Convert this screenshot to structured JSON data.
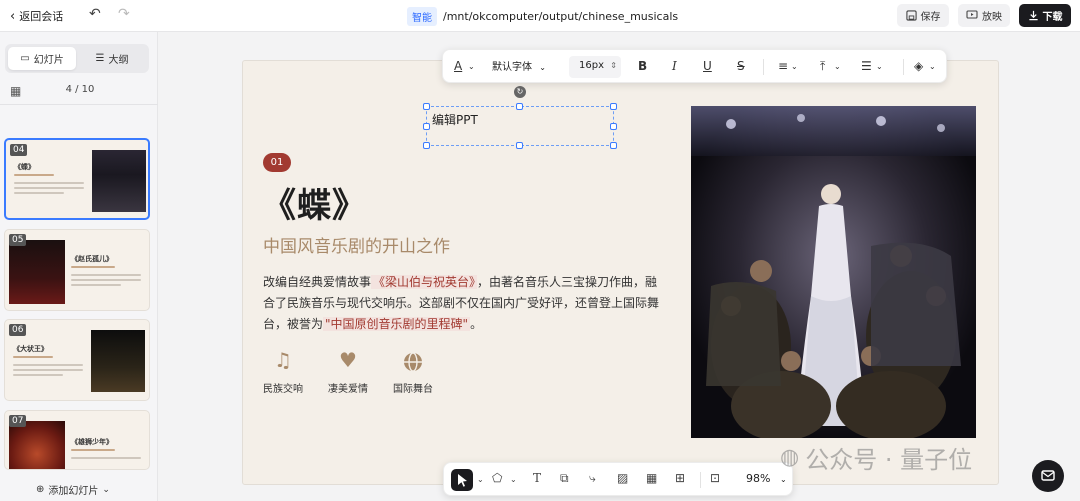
{
  "topbar": {
    "back_label": "返回会话",
    "mode_badge": "智能",
    "path": "/mnt/okcomputer/output/chinese_musicals",
    "save_label": "保存",
    "present_label": "放映",
    "download_label": "下载"
  },
  "sidebar": {
    "tab_slides": "幻灯片",
    "tab_outline": "大纲",
    "page_indicator": "4 / 10",
    "thumbnails": [
      {
        "num": "04",
        "title": "《蝶》",
        "active": true
      },
      {
        "num": "05",
        "title": "《赵氏孤儿》",
        "active": false
      },
      {
        "num": "06",
        "title": "《大状王》",
        "active": false
      },
      {
        "num": "07",
        "title": "《雄狮少年》",
        "active": false
      }
    ],
    "add_slide_label": "添加幻灯片"
  },
  "format_toolbar": {
    "font_family": "默认字体",
    "font_size": "16px"
  },
  "slide": {
    "selected_text": "编辑PPT",
    "badge": "01",
    "title": "《蝶》",
    "subtitle": "中国风音乐剧的开山之作",
    "body_1": "改编自经典爱情故事",
    "body_hl1": "《梁山伯与祝英台》",
    "body_2": "，由著名音乐人三宝操刀作曲，融合了民族音乐与现代交响乐。这部剧不仅在国内广受好评，还曾登上国际舞台，被誉为",
    "body_hl2": "\"中国原创音乐剧的里程碑\"",
    "body_3": "。",
    "features": [
      {
        "icon": "music-note-icon",
        "label": "民族交响"
      },
      {
        "icon": "heart-icon",
        "label": "凄美爱情"
      },
      {
        "icon": "globe-icon",
        "label": "国际舞台"
      }
    ]
  },
  "bottom_toolbar": {
    "zoom": "98%"
  },
  "watermark": "公众号 · 量子位",
  "colors": {
    "accent_red": "#a23a31",
    "accent_gold": "#a88a6a",
    "selection_blue": "#3a7bff",
    "slide_bg": "#f4efe8"
  }
}
